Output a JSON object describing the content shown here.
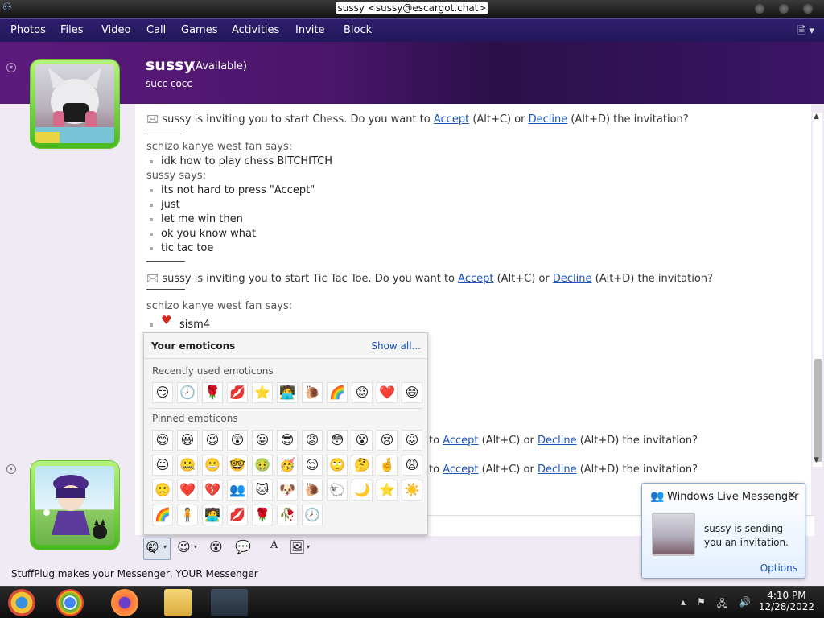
{
  "window": {
    "title": "sussy <sussy@escargot.chat>"
  },
  "menu": [
    "Photos",
    "Files",
    "Video",
    "Call",
    "Games",
    "Activities",
    "Invite",
    "Block"
  ],
  "header": {
    "name": "sussy",
    "status": "(Available)",
    "personal_message": "succ cocc"
  },
  "conversation": {
    "invite_chess": {
      "prefix": "sussy is inviting you to start Chess. Do you want to",
      "accept": "Accept",
      "accept_key": "(Alt+C) or",
      "decline": "Decline",
      "decline_key": "(Alt+D) the invitation?"
    },
    "block1_sender": "schizo kanye west fan says:",
    "block1_msgs": [
      "idk how to play chess BITCHITCH"
    ],
    "block2_sender": "sussy says:",
    "block2_msgs": [
      "its not hard to press \"Accept\"",
      "just",
      "let me win then",
      "ok you know what",
      "tic tac toe"
    ],
    "invite_ttt": {
      "prefix": "sussy is inviting you to start Tic Tac Toe. Do you want to",
      "accept": "Accept",
      "accept_key": "(Alt+C) or",
      "decline": "Decline",
      "decline_key": "(Alt+D) the invitation?"
    },
    "block3_sender": "schizo kanye west fan says:",
    "block3_msg": "sism4",
    "partial_invites": [
      {
        "to": "to",
        "accept": "Accept",
        "accept_key": "(Alt+C) or",
        "decline": "Decline",
        "decline_key": "(Alt+D) the invitation?"
      },
      {
        "to": "to",
        "accept": "Accept",
        "accept_key": "(Alt+C) or",
        "decline": "Decline",
        "decline_key": "(Alt+D) the invitation?"
      }
    ]
  },
  "emoticons": {
    "title": "Your emoticons",
    "show_all": "Show all...",
    "recent_label": "Recently used emoticons",
    "recent": [
      "😏",
      "🕗",
      "🌹",
      "💋",
      "⭐",
      "🧑‍💻",
      "🐌",
      "🌈",
      "😟",
      "❤️",
      "😄"
    ],
    "pinned_label": "Pinned emoticons",
    "pinned": [
      "😊",
      "😃",
      "😉",
      "😲",
      "😛",
      "😎",
      "😡",
      "😳",
      "😵",
      "😢",
      "😖",
      "😐",
      "🤐",
      "😬",
      "🤓",
      "🤢",
      "🥳",
      "😌",
      "🙄",
      "🤔",
      "🤞",
      "😩",
      "🙁",
      "❤️",
      "💔",
      "👥",
      "🐱",
      "🐶",
      "🐌",
      "🐑",
      "🌙",
      "⭐",
      "☀️",
      "🌈",
      "🧍",
      "🧑‍💻",
      "💋",
      "🌹",
      "🥀",
      "🕗"
    ]
  },
  "input_toolbar": {
    "emoticon": "😊",
    "wink": "😉",
    "nudge": "😵",
    "voice_clip": "💬",
    "font": "A",
    "background": "🖼"
  },
  "ad_text": "StuffPlug makes your Messenger, YOUR Messenger",
  "toast": {
    "title": "Windows Live Messenger",
    "message": "sussy is sending you an invitation.",
    "options": "Options",
    "close": "✕"
  },
  "taskbar": {
    "time": "4:10 PM",
    "date": "12/28/2022"
  },
  "colors": {
    "link": "#1a55b8",
    "menubar": "#23175a",
    "avatar_frame": "#46b91b"
  }
}
